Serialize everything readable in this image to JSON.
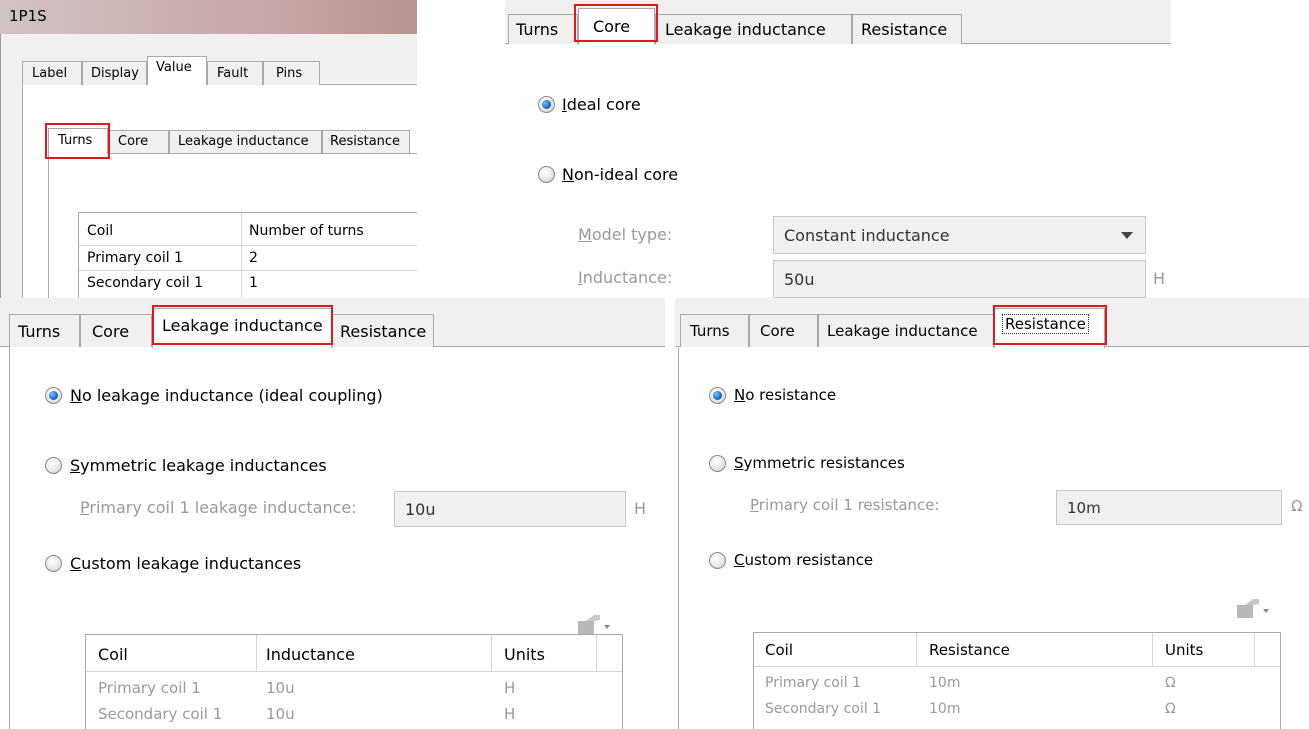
{
  "dialog": {
    "title": "1P1S",
    "main_tabs": [
      "Label",
      "Display",
      "Value",
      "Fault",
      "Pins"
    ],
    "active_main_tab": "Value"
  },
  "sub_tabs": [
    "Turns",
    "Core",
    "Leakage inductance",
    "Resistance"
  ],
  "turns": {
    "columns": [
      "Coil",
      "Number of turns"
    ],
    "rows": [
      {
        "coil": "Primary coil 1",
        "turns": "2"
      },
      {
        "coil": "Secondary coil 1",
        "turns": "1"
      }
    ]
  },
  "core": {
    "ideal_label": "Ideal core",
    "nonideal_label": "Non-ideal core",
    "selected": "ideal",
    "model_type_label": "Model type:",
    "model_type_value": "Constant inductance",
    "inductance_label": "Inductance:",
    "inductance_value": "50u",
    "inductance_unit": "H"
  },
  "leakage": {
    "none_label": "No leakage inductance (ideal coupling)",
    "symmetric_label": "Symmetric leakage inductances",
    "custom_label": "Custom leakage inductances",
    "selected": "none",
    "primary_label": "Primary coil 1 leakage inductance:",
    "primary_value": "10u",
    "primary_unit": "H",
    "columns": [
      "Coil",
      "Inductance",
      "Units"
    ],
    "rows": [
      {
        "coil": "Primary coil 1",
        "value": "10u",
        "unit": "H"
      },
      {
        "coil": "Secondary coil 1",
        "value": "10u",
        "unit": "H"
      }
    ]
  },
  "resistance": {
    "none_label": "No resistance",
    "symmetric_label": "Symmetric resistances",
    "custom_label": "Custom resistance",
    "selected": "none",
    "primary_label": "Primary coil 1 resistance:",
    "primary_value": "10m",
    "primary_unit": "Ω",
    "columns": [
      "Coil",
      "Resistance",
      "Units"
    ],
    "rows": [
      {
        "coil": "Primary coil 1",
        "value": "10m",
        "unit": "Ω"
      },
      {
        "coil": "Secondary coil 1",
        "value": "10m",
        "unit": "Ω"
      }
    ]
  },
  "colors": {
    "highlight": "#e3181c",
    "disabled_text": "#9a9a9a"
  }
}
